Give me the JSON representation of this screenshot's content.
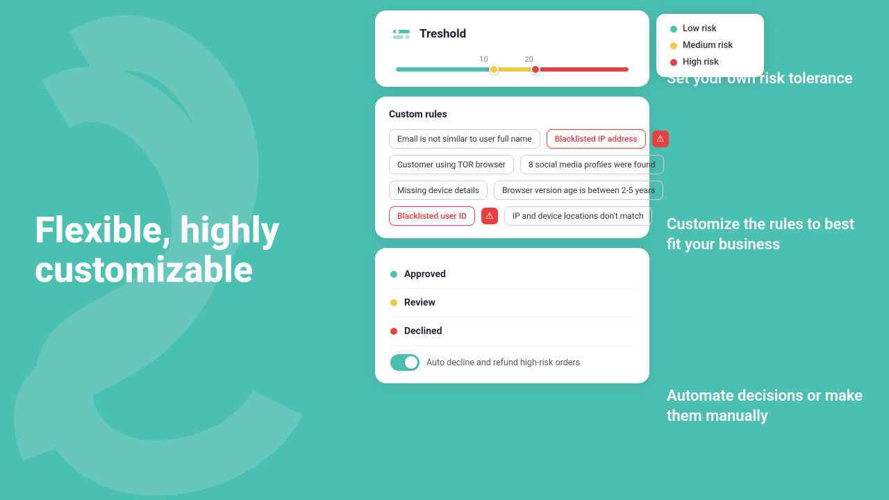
{
  "background": {
    "color": "#4bbfb0"
  },
  "left": {
    "heading_line1": "Flexible, highly",
    "heading_line2": "customizable"
  },
  "right_labels": {
    "label1": "Set your own risk tolerance",
    "label2": "Customize the rules to best fit your business",
    "label3": "Automate decisions or make them manually"
  },
  "card1": {
    "title": "Treshold",
    "slider": {
      "value1": "10",
      "value2": "20"
    },
    "legend": {
      "low": "Low risk",
      "medium": "Medium risk",
      "high": "High risk"
    }
  },
  "card2": {
    "title": "Custom rules",
    "rules": [
      {
        "label": "Email is not similar to user full name",
        "danger": false
      },
      {
        "label": "Blacklisted IP address",
        "danger": true
      },
      {
        "label": "Customer using TOR browser",
        "danger": false
      },
      {
        "label": "8 social media profiles were found",
        "danger": false
      },
      {
        "label": "Missing device details",
        "danger": false
      },
      {
        "label": "Browser version age is between 2-5 years",
        "danger": false
      },
      {
        "label": "Blacklisted user ID",
        "danger": true
      },
      {
        "label": "IP and device locations don't match",
        "danger": false
      }
    ]
  },
  "card3": {
    "decisions": [
      {
        "label": "Approved",
        "color": "#4bbfb0"
      },
      {
        "label": "Review",
        "color": "#f5c842"
      },
      {
        "label": "Declined",
        "color": "#e84040"
      }
    ],
    "toggle_label": "Auto decline and refund high-risk orders"
  }
}
